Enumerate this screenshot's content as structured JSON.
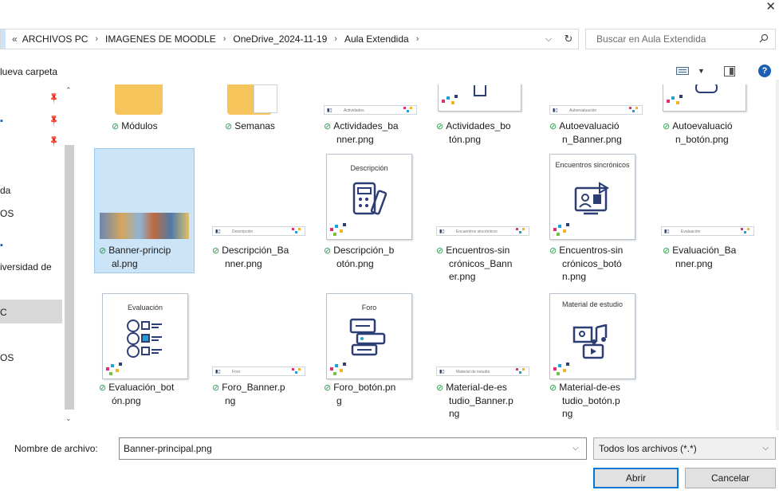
{
  "window": {
    "close_glyph": "✕"
  },
  "address": {
    "overflow": "«",
    "crumbs": [
      "ARCHIVOS PC",
      "IMAGENES DE MOODLE",
      "OneDrive_2024-11-19",
      "Aula Extendida"
    ],
    "separator": "›",
    "dropdown": "⌵",
    "refresh": "↻"
  },
  "search": {
    "placeholder": "Buscar en Aula Extendida",
    "icon": "⚲"
  },
  "toolbar": {
    "new_folder": "lueva carpeta",
    "help": "?"
  },
  "sidebar": {
    "items": [
      "da",
      "OS",
      "iversidad de",
      "C",
      "OS"
    ]
  },
  "files": [
    {
      "name": "Módulos",
      "kind": "folder"
    },
    {
      "name": "Semanas",
      "kind": "folder"
    },
    {
      "name": "Actividades_banner.png",
      "lines": [
        "Actividades_ba",
        "nner.png"
      ],
      "kind": "banner",
      "banner_text": "Actividades"
    },
    {
      "name": "Actividades_botón.png",
      "lines": [
        "Actividades_bo",
        "tón.png"
      ],
      "kind": "card"
    },
    {
      "name": "Autoevaluación_Banner.png",
      "lines": [
        "Autoevaluació",
        "n_Banner.png"
      ],
      "kind": "banner",
      "banner_text": "Autoevaluación"
    },
    {
      "name": "Autoevaluación_botón.png",
      "lines": [
        "Autoevaluació",
        "n_botón.png"
      ],
      "kind": "card"
    },
    {
      "name": "Banner-principal.png",
      "lines": [
        "Banner-princip",
        "al.png"
      ],
      "kind": "photo",
      "selected": true
    },
    {
      "name": "Descripción_Banner.png",
      "lines": [
        "Descripción_Ba",
        "nner.png"
      ],
      "kind": "banner",
      "banner_text": "Descripción"
    },
    {
      "name": "Descripción_botón.png",
      "lines": [
        "Descripción_b",
        "otón.png"
      ],
      "kind": "card",
      "title": "Descripción"
    },
    {
      "name": "Encuentros-sincrónicos_Banner.png",
      "lines": [
        "Encuentros-sin",
        "crónicos_Bann",
        "er.png"
      ],
      "kind": "banner",
      "banner_text": "Encuentros sincrónicos"
    },
    {
      "name": "Encuentros-sincrónicos_botón.png",
      "lines": [
        "Encuentros-sin",
        "crónicos_botó",
        "n.png"
      ],
      "kind": "card",
      "title": "Encuentros sincrónicos"
    },
    {
      "name": "Evaluación_Banner.png",
      "lines": [
        "Evaluación_Ba",
        "nner.png"
      ],
      "kind": "banner",
      "banner_text": "Evaluación"
    },
    {
      "name": "Evaluación_botón.png",
      "lines": [
        "Evaluación_bot",
        "ón.png"
      ],
      "kind": "card",
      "title": "Evaluación"
    },
    {
      "name": "Foro_Banner.png",
      "lines": [
        "Foro_Banner.p",
        "ng"
      ],
      "kind": "banner",
      "banner_text": "Foro"
    },
    {
      "name": "Foro_botón.png",
      "lines": [
        "Foro_botón.pn",
        "g"
      ],
      "kind": "card",
      "title": "Foro"
    },
    {
      "name": "Material-de-estudio_Banner.png",
      "lines": [
        "Material-de-es",
        "tudio_Banner.p",
        "ng"
      ],
      "kind": "banner",
      "banner_text": "Material de estudio"
    },
    {
      "name": "Material-de-estudio_botón.png",
      "lines": [
        "Material-de-es",
        "tudio_botón.p",
        "ng"
      ],
      "kind": "card",
      "title": "Material de estudio"
    }
  ],
  "footer": {
    "filename_label": "Nombre de archivo:",
    "filename_value": "Banner-principal.png",
    "filter": "Todos los archivos (*.*)",
    "open": "Abrir",
    "cancel": "Cancelar"
  },
  "colors": {
    "selection": "#cce4f7",
    "accent": "#0078d7",
    "check": "#27a04a",
    "folder": "#f5c55b"
  }
}
